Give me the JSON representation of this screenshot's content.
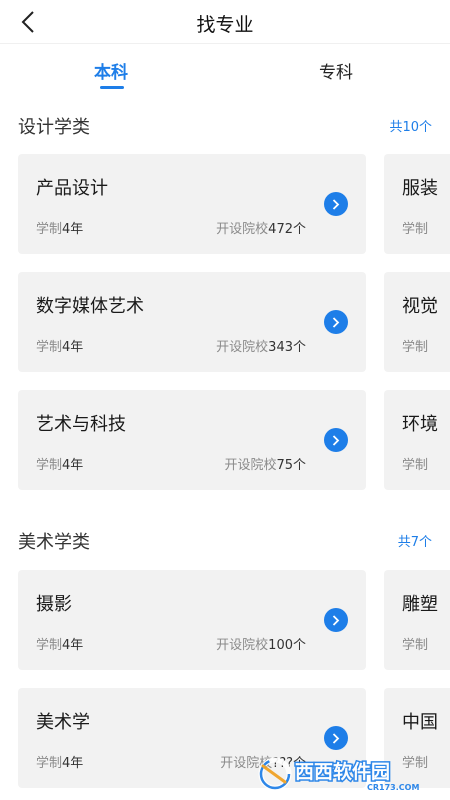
{
  "header": {
    "title": "找专业"
  },
  "tabs": [
    {
      "label": "本科",
      "active": true
    },
    {
      "label": "专科",
      "active": false
    }
  ],
  "colors": {
    "accent": "#1e7ee8",
    "card_bg": "#f2f2f2"
  },
  "sections": [
    {
      "title": "设计学类",
      "count": "共10个",
      "cards": [
        {
          "name": "产品设计",
          "years_label": "学制",
          "years": "4年",
          "schools_label": "开设院校",
          "schools": "472个"
        },
        {
          "name": "数字媒体艺术",
          "years_label": "学制",
          "years": "4年",
          "schools_label": "开设院校",
          "schools": "343个"
        },
        {
          "name": "艺术与科技",
          "years_label": "学制",
          "years": "4年",
          "schools_label": "开设院校",
          "schools": "75个"
        }
      ],
      "peek": [
        {
          "name": "服装",
          "years_label": "学制"
        },
        {
          "name": "视觉",
          "years_label": "学制"
        },
        {
          "name": "环境",
          "years_label": "学制"
        }
      ]
    },
    {
      "title": "美术学类",
      "count": "共7个",
      "cards": [
        {
          "name": "摄影",
          "years_label": "学制",
          "years": "4年",
          "schools_label": "开设院校",
          "schools": "100个"
        },
        {
          "name": "美术学",
          "years_label": "学制",
          "years": "4年",
          "schools_label": "开设院校",
          "schools": "???个"
        }
      ],
      "peek": [
        {
          "name": "雕塑",
          "years_label": "学制"
        },
        {
          "name": "中国",
          "years_label": "学制"
        }
      ]
    }
  ],
  "watermark": {
    "brand": "西西软件园",
    "domain": "CR173.COM"
  }
}
